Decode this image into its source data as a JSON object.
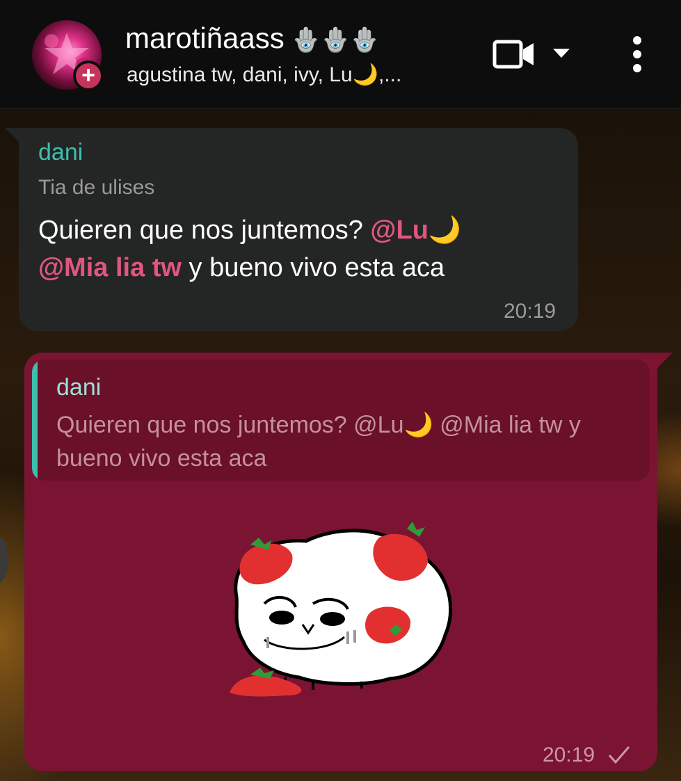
{
  "header": {
    "title": "marotiñaass",
    "title_emoji": "🪬🪬🪬",
    "subtitle": "agustina tw, dani, ivy, Lu🌙,..."
  },
  "messages": [
    {
      "sender": "dani",
      "role": "Tia de ulises",
      "text_start": "Quieren que nos juntemos? ",
      "mention1": "@Lu🌙",
      "mention2": "@Mia lia tw",
      "text_end": " y bueno vivo esta aca",
      "time": "20:19"
    },
    {
      "quote_sender": "dani",
      "quote_text": "Quieren que nos juntemos? @Lu🌙 @Mia lia tw y bueno vivo esta aca",
      "time": "20:19"
    }
  ],
  "colors": {
    "accent_teal": "#3dbfae",
    "mention_pink": "#e0577e",
    "outgoing_bubble": "#7a1432",
    "incoming_bubble": "#242525"
  }
}
